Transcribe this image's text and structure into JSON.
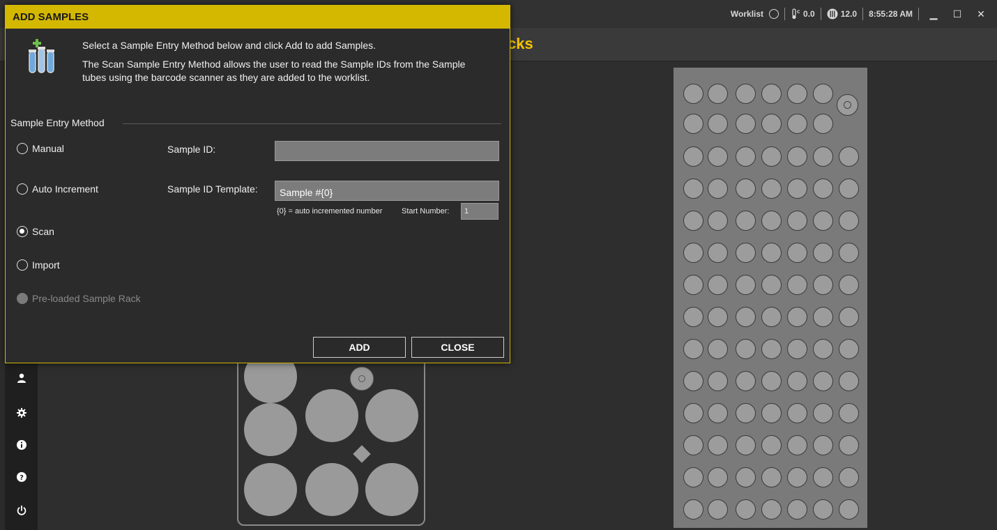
{
  "topbar": {
    "worklist_label": "Worklist",
    "temperature": "0.0",
    "reagent_level": "12.0",
    "time": "8:55:28 AM",
    "minimize": "▁",
    "maximize": "☐",
    "close": "✕"
  },
  "page": {
    "title_fragment": "cks"
  },
  "dialog": {
    "title": "ADD SAMPLES",
    "intro": "Select a Sample Entry Method below and click Add to add Samples.",
    "description": "The Scan Sample Entry Method allows the user to read the Sample IDs from the Sample tubes using the barcode scanner as they are added to the worklist.",
    "section_label": "Sample Entry Method",
    "methods": [
      {
        "label": "Manual",
        "selected": false,
        "enabled": true
      },
      {
        "label": "Auto Increment",
        "selected": false,
        "enabled": true
      },
      {
        "label": "Scan",
        "selected": true,
        "enabled": true
      },
      {
        "label": "Import",
        "selected": false,
        "enabled": true
      },
      {
        "label": "Pre-loaded Sample Rack",
        "selected": false,
        "enabled": false
      }
    ],
    "sample_id_label": "Sample ID:",
    "sample_id_value": "",
    "template_label": "Sample ID Template:",
    "template_value": "Sample #{0}",
    "template_hint": "{0} = auto incremented number",
    "start_number_label": "Start Number:",
    "start_number_value": "1",
    "add_button": "ADD",
    "close_button": "CLOSE"
  },
  "sidebar": {
    "icons": [
      "user-icon",
      "gear-icon",
      "info-icon",
      "help-icon",
      "power-icon"
    ]
  },
  "colors": {
    "accent": "#d4b800",
    "title_yellow": "#f5c400",
    "well": "#9c9c9c",
    "rack": "#7a7a7a"
  }
}
